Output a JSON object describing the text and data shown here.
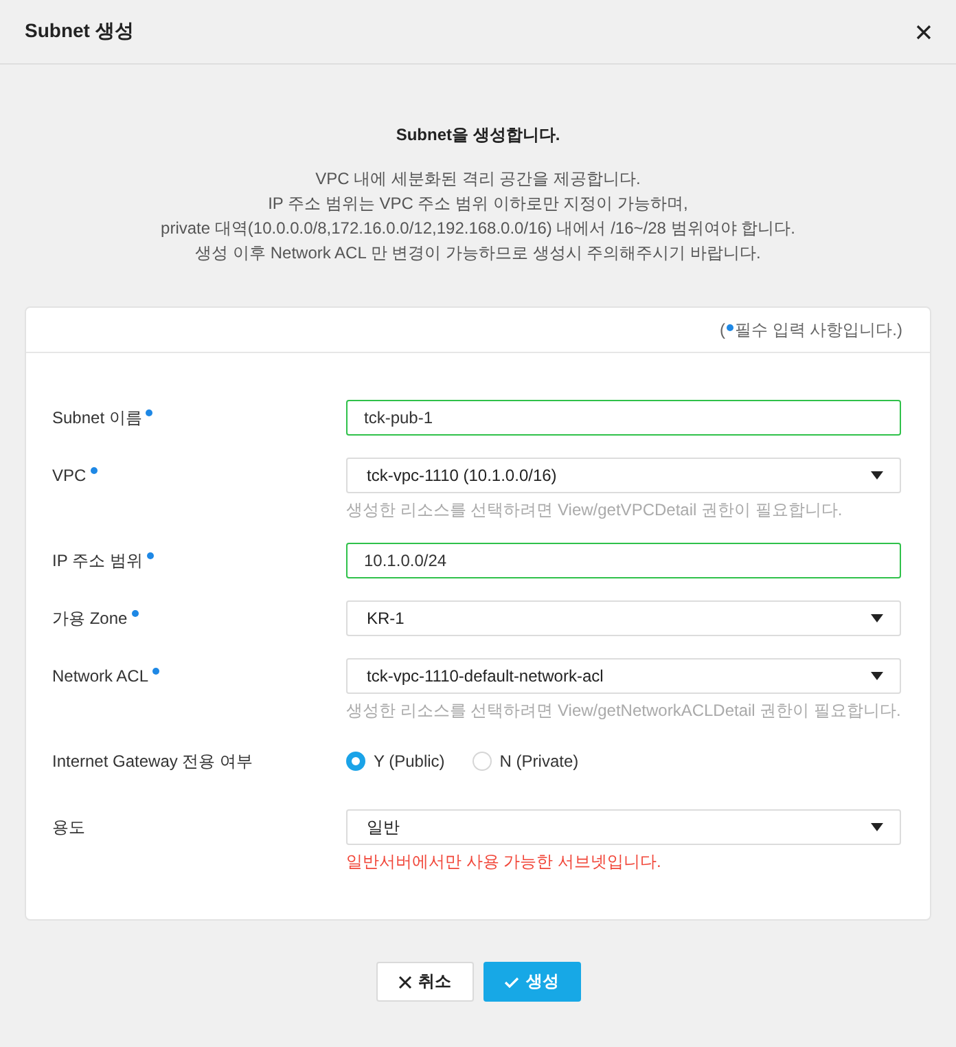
{
  "dialog": {
    "title": "Subnet 생성"
  },
  "intro": {
    "heading": "Subnet을 생성합니다.",
    "lines": [
      "VPC 내에 세분화된 격리 공간을 제공합니다.",
      "IP 주소 범위는 VPC 주소 범위 이하로만 지정이 가능하며,",
      "private 대역(10.0.0.0/8,172.16.0.0/12,192.168.0.0/16) 내에서 /16~/28 범위여야 합니다.",
      "생성 이후 Network ACL 만 변경이 가능하므로 생성시 주의해주시기 바랍니다."
    ]
  },
  "form": {
    "required_note": {
      "before": "(",
      "text": "필수 입력 사항입니다.)"
    },
    "fields": [
      {
        "kind": "text",
        "label": "Subnet 이름",
        "required": true,
        "value": "tck-pub-1",
        "valid": true
      },
      {
        "kind": "select",
        "label": "VPC",
        "required": true,
        "value": "tck-vpc-1110 (10.1.0.0/16)",
        "hint": {
          "text": "생성한 리소스를 선택하려면 View/getVPCDetail 권한이 필요합니다.",
          "warning": false
        }
      },
      {
        "kind": "text",
        "label": "IP 주소 범위",
        "required": true,
        "value": "10.1.0.0/24",
        "valid": true
      },
      {
        "kind": "select",
        "label": "가용 Zone",
        "required": true,
        "value": "KR-1"
      },
      {
        "kind": "select",
        "label": "Network ACL",
        "required": true,
        "value": "tck-vpc-1110-default-network-acl",
        "hint": {
          "text": "생성한 리소스를 선택하려면 View/getNetworkACLDetail 권한이 필요합니다.",
          "warning": false
        }
      },
      {
        "kind": "radio",
        "label": "Internet Gateway 전용 여부",
        "required": false,
        "options": [
          {
            "label": "Y (Public)",
            "selected": true
          },
          {
            "label": "N (Private)",
            "selected": false
          }
        ]
      },
      {
        "kind": "select",
        "label": "용도",
        "required": false,
        "value": "일반",
        "hint": {
          "text": "일반서버에서만 사용 가능한 서브넷입니다.",
          "warning": true
        }
      }
    ]
  },
  "buttons": [
    {
      "kind": "cancel",
      "label": "취소"
    },
    {
      "kind": "primary",
      "label": "생성"
    }
  ]
}
